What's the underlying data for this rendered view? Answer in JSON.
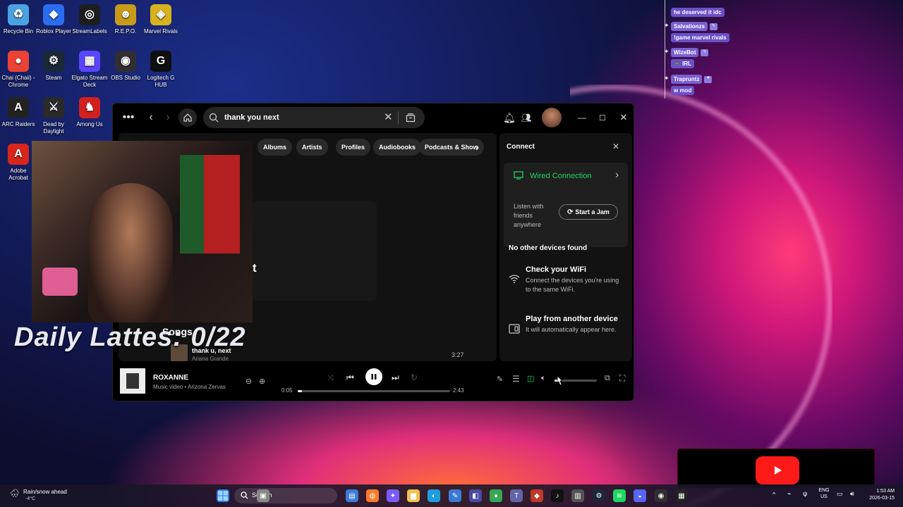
{
  "desktop": {
    "icons": [
      {
        "label": "Recycle Bin",
        "icon": "recycle-bin-icon",
        "color": "#4aa3e0"
      },
      {
        "label": "Roblox Player",
        "icon": "roblox-icon",
        "color": "#2b6df0"
      },
      {
        "label": "StreamLabels",
        "icon": "streamlabels-icon",
        "color": "#1e1e1e"
      },
      {
        "label": "R.E.P.O.",
        "icon": "repo-icon",
        "color": "#c89a1a"
      },
      {
        "label": "Marvel Rivals",
        "icon": "marvel-rivals-icon",
        "color": "#d6b21e"
      },
      {
        "label": "Chai (Chaii) - Chrome",
        "icon": "chrome-icon",
        "color": "#ea4335"
      },
      {
        "label": "Steam",
        "icon": "steam-icon",
        "color": "#1b2838"
      },
      {
        "label": "Elgato Stream Deck",
        "icon": "stream-deck-icon",
        "color": "#5a46ff"
      },
      {
        "label": "OBS Studio",
        "icon": "obs-icon",
        "color": "#302e31"
      },
      {
        "label": "Logitech G HUB",
        "icon": "logitech-icon",
        "color": "#0f0f0f"
      },
      {
        "label": "ARC Raiders",
        "icon": "arc-raiders-icon",
        "color": "#222"
      },
      {
        "label": "Dead by Daylight",
        "icon": "dbd-icon",
        "color": "#2a2a2a"
      },
      {
        "label": "Among Us",
        "icon": "among-us-icon",
        "color": "#d41f1f"
      },
      {
        "label": "Adobe Acrobat",
        "icon": "acrobat-icon",
        "color": "#d9261c"
      }
    ]
  },
  "chat": {
    "messages": [
      {
        "user": "",
        "text": "he deserved it idc"
      },
      {
        "user": "Salvationzs",
        "text": "!game marvel rivals"
      },
      {
        "user": "WizeBot",
        "text": "🎮 IRL"
      },
      {
        "user": "Trapruntz",
        "text": "w mod"
      }
    ]
  },
  "spotify": {
    "search_query": "thank you next",
    "filters": [
      "Albums",
      "Artists",
      "Profiles",
      "Audiobooks",
      "Podcasts & Show"
    ],
    "songs_heading": "Songs",
    "top_result_partial": "t",
    "song_row": {
      "title": "thank u, next",
      "artist": "Ariana Grande",
      "duration": "3:27"
    },
    "connect": {
      "title": "Connect",
      "wired": "Wired Connection",
      "listen_text": "Listen with friends anywhere",
      "jam_button": "Start a Jam",
      "no_devices": "No other devices found",
      "wifi_title": "Check your WiFi",
      "wifi_desc": "Connect the devices you're using to the same WiFi.",
      "another_title": "Play from another device",
      "another_desc": "It will automatically appear here."
    },
    "now_playing": {
      "title": "ROXANNE",
      "subtitle": "Music video • Arizona Zervas",
      "elapsed": "0:05",
      "total": "2:43",
      "progress": 0.03,
      "volume": 0.08
    },
    "accent": "#1ed760"
  },
  "stream_overlay": {
    "counter_text": "Daily Lattes: 0/22"
  },
  "taskbar": {
    "weather_title": "Rain/snow ahead",
    "weather_temp": "-4°C",
    "search_label": "Search",
    "lang_top": "ENG",
    "lang_bottom": "US",
    "time": "1:53 AM",
    "date": "2026-03-15"
  }
}
